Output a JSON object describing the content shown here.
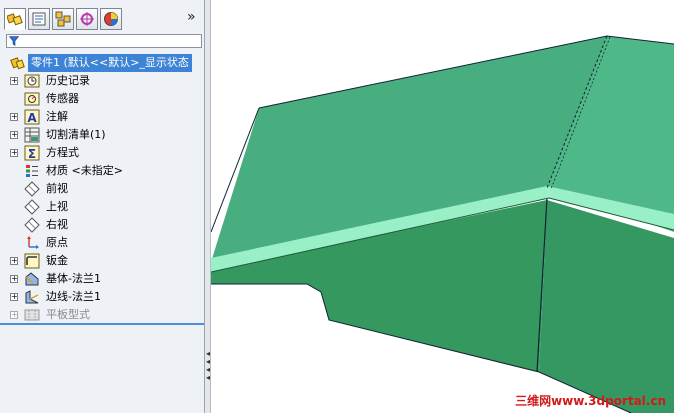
{
  "feature_manager": {
    "tabs": [
      {
        "name": "featuremanager-tab",
        "icon": "feature-tree-icon"
      },
      {
        "name": "propertymanager-tab",
        "icon": "property-manager-icon"
      },
      {
        "name": "configurationmanager-tab",
        "icon": "configuration-manager-icon"
      },
      {
        "name": "dimxpertmanager-tab",
        "icon": "dimxpert-icon"
      },
      {
        "name": "displaymanager-tab",
        "icon": "display-manager-icon"
      }
    ],
    "expand_glyph": "»",
    "filter_icon": "filter-icon",
    "root": {
      "label": "零件1  (默认<<默认>_显示状态",
      "icon": "part-icon"
    },
    "items": [
      {
        "label": "历史记录",
        "icon": "history-folder-icon",
        "expander": "+"
      },
      {
        "label": "传感器",
        "icon": "sensor-folder-icon",
        "expander": ""
      },
      {
        "label": "注解",
        "icon": "annotation-icon",
        "expander": "+"
      },
      {
        "label": "切割清单(1)",
        "icon": "cut-list-icon",
        "expander": "+"
      },
      {
        "label": "方程式",
        "icon": "equations-icon",
        "expander": "+"
      },
      {
        "label": "材质 <未指定>",
        "icon": "material-icon",
        "expander": ""
      },
      {
        "label": "前视",
        "icon": "plane-icon",
        "expander": ""
      },
      {
        "label": "上视",
        "icon": "plane-icon",
        "expander": ""
      },
      {
        "label": "右视",
        "icon": "plane-icon",
        "expander": ""
      },
      {
        "label": "原点",
        "icon": "origin-icon",
        "expander": ""
      },
      {
        "label": "钣金",
        "icon": "sheet-metal-icon",
        "expander": "+"
      },
      {
        "label": "基体-法兰1",
        "icon": "base-flange-icon",
        "expander": "+"
      },
      {
        "label": "边线-法兰1",
        "icon": "edge-flange-icon",
        "expander": "+"
      },
      {
        "label": "平板型式",
        "icon": "flat-pattern-icon",
        "expander": "+",
        "suppressed": true
      }
    ]
  },
  "viewport": {
    "model_color": "#3a9a6a",
    "watermark": "三维网www.3dportal.cn"
  },
  "colors": {
    "selection": "#3d84d6",
    "panel_bg": "#eef1f6",
    "model_top": "#4db487",
    "model_side": "#38a068",
    "bend_highlight": "#9af0c6"
  }
}
